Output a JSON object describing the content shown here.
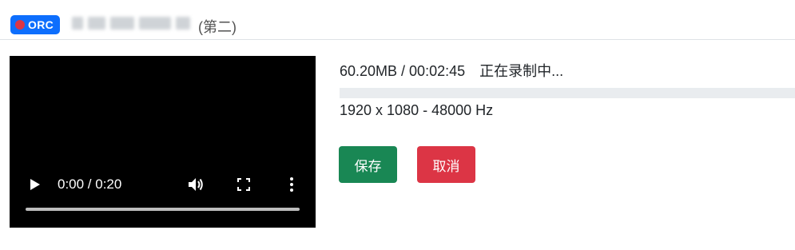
{
  "header": {
    "badge_label": "ORC",
    "title_visible": "(第二)",
    "colors": {
      "badge_bg": "#0d6efd",
      "rec_dot": "#dc3545"
    }
  },
  "video": {
    "time": "0:00 / 0:20",
    "progress": 0,
    "icons": {
      "play": "play-icon",
      "volume": "volume-icon",
      "fullscreen": "fullscreen-icon",
      "more": "more-vertical-icon"
    }
  },
  "info": {
    "size_duration": "60.20MB / 00:02:45",
    "status": "正在录制中...",
    "resolution": "1920 x 1080 - 48000 Hz"
  },
  "actions": {
    "save_label": "保存",
    "cancel_label": "取消",
    "colors": {
      "save": "#198754",
      "cancel": "#dc3545"
    }
  }
}
